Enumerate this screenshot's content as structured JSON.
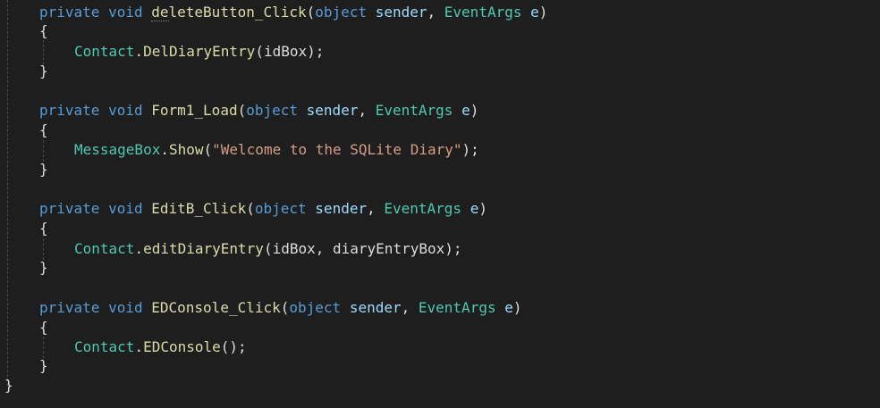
{
  "code": {
    "methods": [
      {
        "modifier": "private",
        "ret": "void",
        "name_part1": "de",
        "name_part2": "leteButton_Click",
        "param_type1": "object",
        "param_name1": "sender",
        "param_type2": "EventArgs",
        "param_name2": "e",
        "body_class": "Contact",
        "body_method": "DelDiaryEntry",
        "body_args": "idBox",
        "body_suffix": ");"
      },
      {
        "modifier": "private",
        "ret": "void",
        "name": "Form1_Load",
        "param_type1": "object",
        "param_name1": "sender",
        "param_type2": "EventArgs",
        "param_name2": "e",
        "body_class": "MessageBox",
        "body_method": "Show",
        "body_string": "\"Welcome to the SQLite Diary\"",
        "body_suffix": ");"
      },
      {
        "modifier": "private",
        "ret": "void",
        "name": "EditB_Click",
        "param_type1": "object",
        "param_name1": "sender",
        "param_type2": "EventArgs",
        "param_name2": "e",
        "body_class": "Contact",
        "body_method": "editDiaryEntry",
        "body_args": "idBox, diaryEntryBox",
        "body_suffix": ");"
      },
      {
        "modifier": "private",
        "ret": "void",
        "name": "EDConsole_Click",
        "param_type1": "object",
        "param_name1": "sender",
        "param_type2": "EventArgs",
        "param_name2": "e",
        "body_class": "Contact",
        "body_method": "EDConsole",
        "body_args": "",
        "body_suffix": ");"
      }
    ],
    "open_brace": "{",
    "close_brace": "}"
  },
  "colors": {
    "background": "#1e1e1e",
    "keyword": "#569cd6",
    "type": "#4ec9b0",
    "method": "#dcdcaa",
    "parameter": "#9cdcfe",
    "string": "#d69d85"
  }
}
